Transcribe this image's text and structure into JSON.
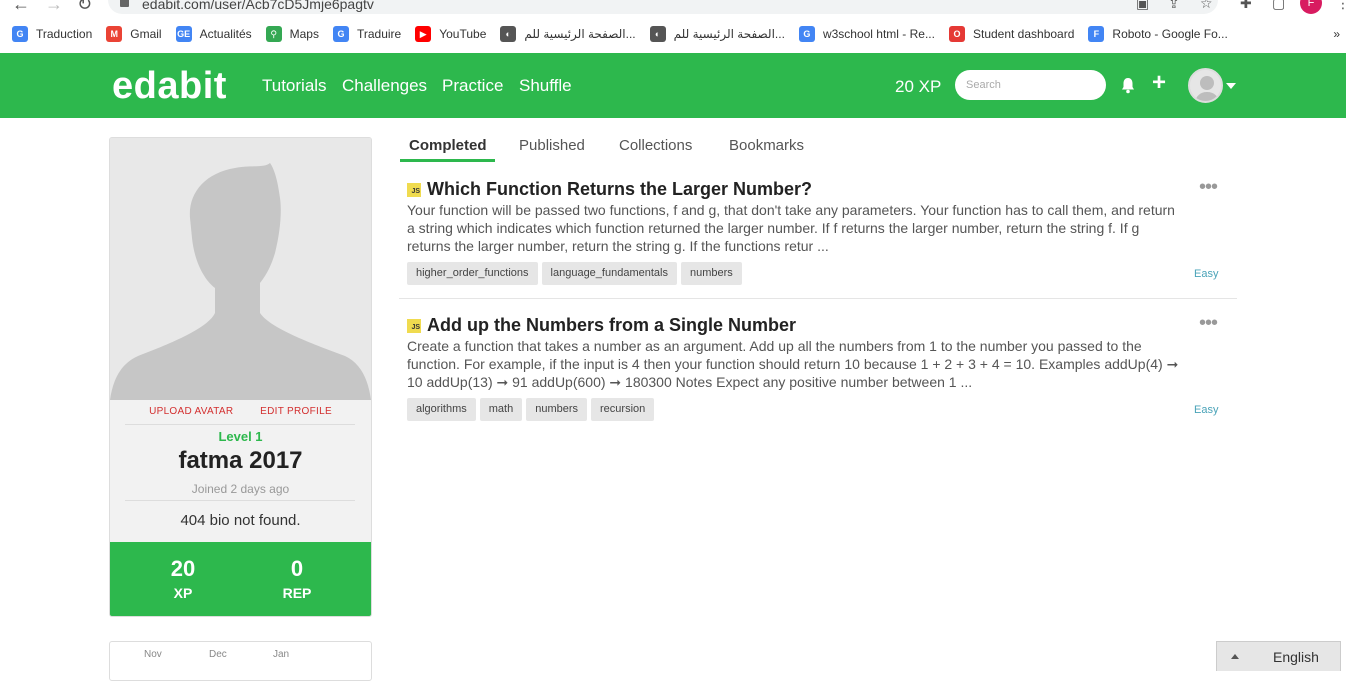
{
  "browser": {
    "url": "edabit.com/user/Acb7cD5Jmje6pagtv",
    "profile_initial": "F"
  },
  "bookmarks": [
    {
      "label": "Traduction",
      "icon": "google-translate-icon",
      "color": "#4285f4",
      "glyph": "G"
    },
    {
      "label": "Gmail",
      "icon": "gmail-icon",
      "color": "#ea4335",
      "glyph": "M"
    },
    {
      "label": "Actualités",
      "icon": "google-news-icon",
      "color": "#4285f4",
      "glyph": "GE"
    },
    {
      "label": "Maps",
      "icon": "google-maps-icon",
      "color": "#34a853",
      "glyph": "⚲"
    },
    {
      "label": "Traduire",
      "icon": "google-translate-icon",
      "color": "#4285f4",
      "glyph": "G"
    },
    {
      "label": "YouTube",
      "icon": "youtube-icon",
      "color": "#ff0000",
      "glyph": "▶"
    },
    {
      "label": "الصفحة الرئيسية للم...",
      "icon": "globe-icon",
      "color": "#555555",
      "glyph": "◐"
    },
    {
      "label": "الصفحة الرئيسية للم...",
      "icon": "globe-icon",
      "color": "#555555",
      "glyph": "◐"
    },
    {
      "label": "w3school html - Re...",
      "icon": "google-icon",
      "color": "#4285f4",
      "glyph": "G"
    },
    {
      "label": "Student dashboard",
      "icon": "student-dashboard-icon",
      "color": "#e53935",
      "glyph": "O"
    },
    {
      "label": "Roboto - Google Fo...",
      "icon": "google-fonts-icon",
      "color": "#4285f4",
      "glyph": "F"
    }
  ],
  "bookmarks_more": "»",
  "nav": {
    "logo": "edabit",
    "links": [
      "Tutorials",
      "Challenges",
      "Practice",
      "Shuffle"
    ],
    "xp": "20 XP",
    "search_placeholder": "Search"
  },
  "profile": {
    "upload_avatar": "UPLOAD AVATAR",
    "edit_profile": "EDIT PROFILE",
    "level": "Level 1",
    "username": "fatma 2017",
    "joined": "Joined 2 days ago",
    "bio": "404 bio not found.",
    "xp_value": "20",
    "xp_label": "XP",
    "rep_value": "0",
    "rep_label": "REP",
    "months": [
      "Nov",
      "Dec",
      "Jan"
    ]
  },
  "tabs": [
    "Completed",
    "Published",
    "Collections",
    "Bookmarks"
  ],
  "challenges": [
    {
      "lang": "JS",
      "title": "Which Function Returns the Larger Number?",
      "description": "Your function will be passed two functions, f and g, that don't take any parameters. Your function has to call them, and return a string which indicates which function returned the larger number. If f returns the larger number, return the string f. If g returns the larger number, return the string g. If the functions retur ...",
      "tags": [
        "higher_order_functions",
        "language_fundamentals",
        "numbers"
      ],
      "difficulty": "Easy"
    },
    {
      "lang": "JS",
      "title": "Add up the Numbers from a Single Number",
      "description": "Create a function that takes a number as an argument. Add up all the numbers from 1 to the number you passed to the function. For example, if the input is 4 then your function should return 10 because 1 + 2 + 3 + 4 = 10. Examples addUp(4) ➞ 10 addUp(13) ➞ 91 addUp(600) ➞ 180300 Notes Expect any positive number between 1 ...",
      "tags": [
        "algorithms",
        "math",
        "numbers",
        "recursion"
      ],
      "difficulty": "Easy"
    }
  ],
  "more_menu_glyph": "•••",
  "language_button": "English"
}
